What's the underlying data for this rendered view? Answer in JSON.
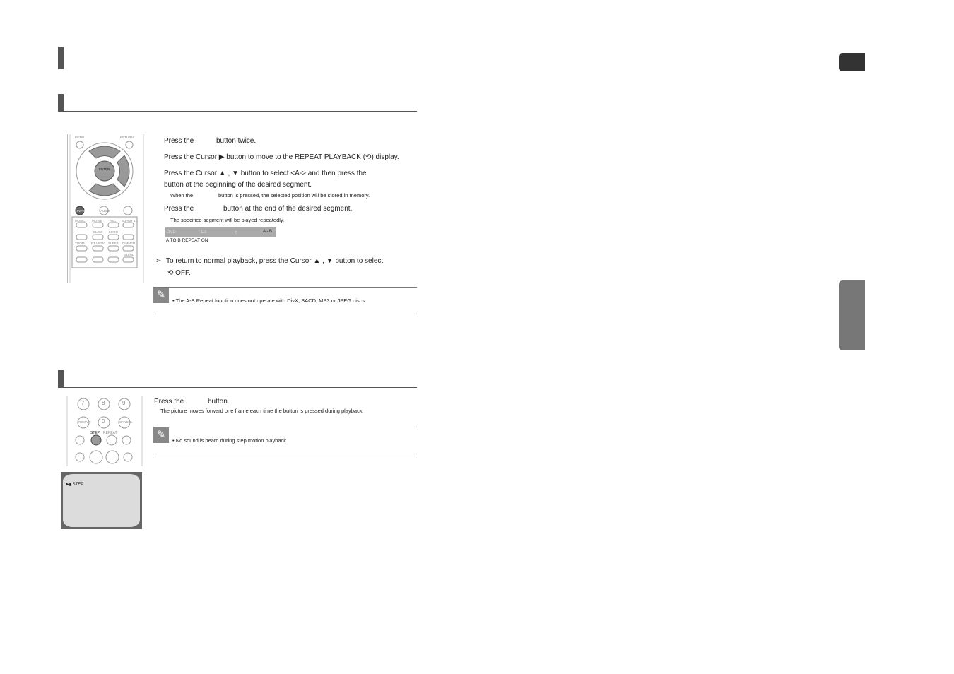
{
  "section1": {
    "steps": [
      "Press the",
      "button twice.",
      "Press the Cursor ▶ button to move to the REPEAT PLAYBACK (",
      "⟲",
      ") display.",
      "Press the Cursor  ▲ , ▼ button to select <A-> and then press the",
      "button at the beginning of the desired segment.",
      "When the",
      "button is pressed, the selected position will be stored in memory.",
      "Press the",
      "button at the end of the desired segment.",
      "The specified segment will be played repeatedly."
    ],
    "osd": {
      "items": [
        "DVD",
        "1/3",
        "⟲",
        "A - B"
      ],
      "caption": "A TO B REPEAT ON"
    },
    "tip": "To return to normal playback, press the Cursor  ▲ , ▼ button to select",
    "tip2": "⟲ OFF.",
    "note": "• The A-B Repeat function does not operate with DivX, SACD, MP3 or JPEG discs."
  },
  "remote1": {
    "labels": [
      "MENU",
      "RETURN",
      "ENTER",
      "INFO",
      "AUDIO",
      "SUB TITLE",
      "MUSIC",
      "MOVIE",
      "ASC",
      "SUPER 5.1",
      "TUNER MEMORY",
      "SLOW",
      "LOGO",
      "SOUND EDIT",
      "ZOOM",
      "EZ VIEW",
      "SLEEP",
      "DIMMER",
      "PL II",
      "HDMI AUDIO",
      "SD/HD",
      "MODE",
      "EFFECT",
      "SELECT"
    ]
  },
  "section2": {
    "step1a": "Press the",
    "step1b": "button.",
    "sub": "The picture moves forward one frame each time the button is pressed during playback.",
    "note": "• No sound is heard during step motion playback.",
    "screen": "▶▮ STEP"
  },
  "remote2": {
    "labels": [
      "7",
      "8",
      "9",
      "REMAIN",
      "0",
      "CANCEL",
      "STEP",
      "REPEAT"
    ]
  }
}
